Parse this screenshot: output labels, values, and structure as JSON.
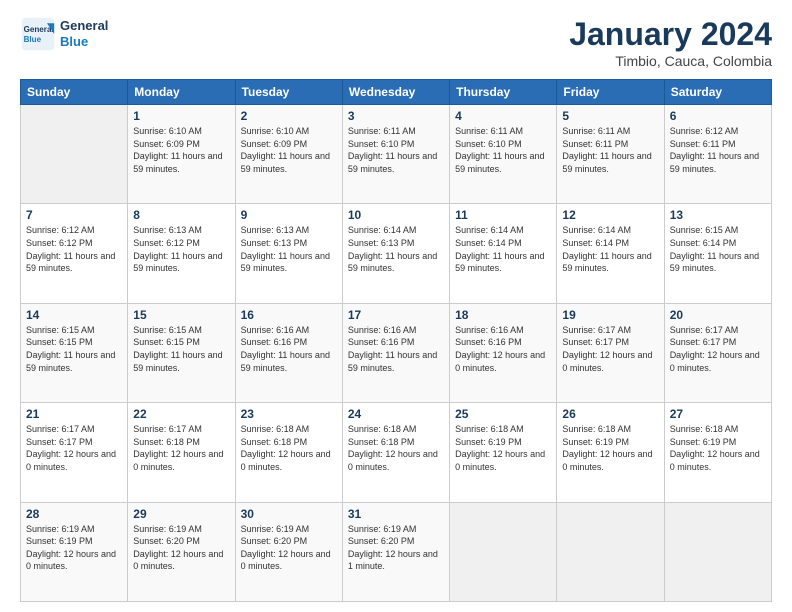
{
  "logo": {
    "line1": "General",
    "line2": "Blue"
  },
  "title": "January 2024",
  "subtitle": "Timbio, Cauca, Colombia",
  "weekdays": [
    "Sunday",
    "Monday",
    "Tuesday",
    "Wednesday",
    "Thursday",
    "Friday",
    "Saturday"
  ],
  "weeks": [
    [
      null,
      {
        "day": 1,
        "sunrise": "6:10 AM",
        "sunset": "6:09 PM",
        "daylight": "11 hours and 59 minutes."
      },
      {
        "day": 2,
        "sunrise": "6:10 AM",
        "sunset": "6:09 PM",
        "daylight": "11 hours and 59 minutes."
      },
      {
        "day": 3,
        "sunrise": "6:11 AM",
        "sunset": "6:10 PM",
        "daylight": "11 hours and 59 minutes."
      },
      {
        "day": 4,
        "sunrise": "6:11 AM",
        "sunset": "6:10 PM",
        "daylight": "11 hours and 59 minutes."
      },
      {
        "day": 5,
        "sunrise": "6:11 AM",
        "sunset": "6:11 PM",
        "daylight": "11 hours and 59 minutes."
      },
      {
        "day": 6,
        "sunrise": "6:12 AM",
        "sunset": "6:11 PM",
        "daylight": "11 hours and 59 minutes."
      }
    ],
    [
      {
        "day": 7,
        "sunrise": "6:12 AM",
        "sunset": "6:12 PM",
        "daylight": "11 hours and 59 minutes."
      },
      {
        "day": 8,
        "sunrise": "6:13 AM",
        "sunset": "6:12 PM",
        "daylight": "11 hours and 59 minutes."
      },
      {
        "day": 9,
        "sunrise": "6:13 AM",
        "sunset": "6:13 PM",
        "daylight": "11 hours and 59 minutes."
      },
      {
        "day": 10,
        "sunrise": "6:14 AM",
        "sunset": "6:13 PM",
        "daylight": "11 hours and 59 minutes."
      },
      {
        "day": 11,
        "sunrise": "6:14 AM",
        "sunset": "6:14 PM",
        "daylight": "11 hours and 59 minutes."
      },
      {
        "day": 12,
        "sunrise": "6:14 AM",
        "sunset": "6:14 PM",
        "daylight": "11 hours and 59 minutes."
      },
      {
        "day": 13,
        "sunrise": "6:15 AM",
        "sunset": "6:14 PM",
        "daylight": "11 hours and 59 minutes."
      }
    ],
    [
      {
        "day": 14,
        "sunrise": "6:15 AM",
        "sunset": "6:15 PM",
        "daylight": "11 hours and 59 minutes."
      },
      {
        "day": 15,
        "sunrise": "6:15 AM",
        "sunset": "6:15 PM",
        "daylight": "11 hours and 59 minutes."
      },
      {
        "day": 16,
        "sunrise": "6:16 AM",
        "sunset": "6:16 PM",
        "daylight": "11 hours and 59 minutes."
      },
      {
        "day": 17,
        "sunrise": "6:16 AM",
        "sunset": "6:16 PM",
        "daylight": "11 hours and 59 minutes."
      },
      {
        "day": 18,
        "sunrise": "6:16 AM",
        "sunset": "6:16 PM",
        "daylight": "12 hours and 0 minutes."
      },
      {
        "day": 19,
        "sunrise": "6:17 AM",
        "sunset": "6:17 PM",
        "daylight": "12 hours and 0 minutes."
      },
      {
        "day": 20,
        "sunrise": "6:17 AM",
        "sunset": "6:17 PM",
        "daylight": "12 hours and 0 minutes."
      }
    ],
    [
      {
        "day": 21,
        "sunrise": "6:17 AM",
        "sunset": "6:17 PM",
        "daylight": "12 hours and 0 minutes."
      },
      {
        "day": 22,
        "sunrise": "6:17 AM",
        "sunset": "6:18 PM",
        "daylight": "12 hours and 0 minutes."
      },
      {
        "day": 23,
        "sunrise": "6:18 AM",
        "sunset": "6:18 PM",
        "daylight": "12 hours and 0 minutes."
      },
      {
        "day": 24,
        "sunrise": "6:18 AM",
        "sunset": "6:18 PM",
        "daylight": "12 hours and 0 minutes."
      },
      {
        "day": 25,
        "sunrise": "6:18 AM",
        "sunset": "6:19 PM",
        "daylight": "12 hours and 0 minutes."
      },
      {
        "day": 26,
        "sunrise": "6:18 AM",
        "sunset": "6:19 PM",
        "daylight": "12 hours and 0 minutes."
      },
      {
        "day": 27,
        "sunrise": "6:18 AM",
        "sunset": "6:19 PM",
        "daylight": "12 hours and 0 minutes."
      }
    ],
    [
      {
        "day": 28,
        "sunrise": "6:19 AM",
        "sunset": "6:19 PM",
        "daylight": "12 hours and 0 minutes."
      },
      {
        "day": 29,
        "sunrise": "6:19 AM",
        "sunset": "6:20 PM",
        "daylight": "12 hours and 0 minutes."
      },
      {
        "day": 30,
        "sunrise": "6:19 AM",
        "sunset": "6:20 PM",
        "daylight": "12 hours and 0 minutes."
      },
      {
        "day": 31,
        "sunrise": "6:19 AM",
        "sunset": "6:20 PM",
        "daylight": "12 hours and 1 minute."
      },
      null,
      null,
      null
    ]
  ]
}
